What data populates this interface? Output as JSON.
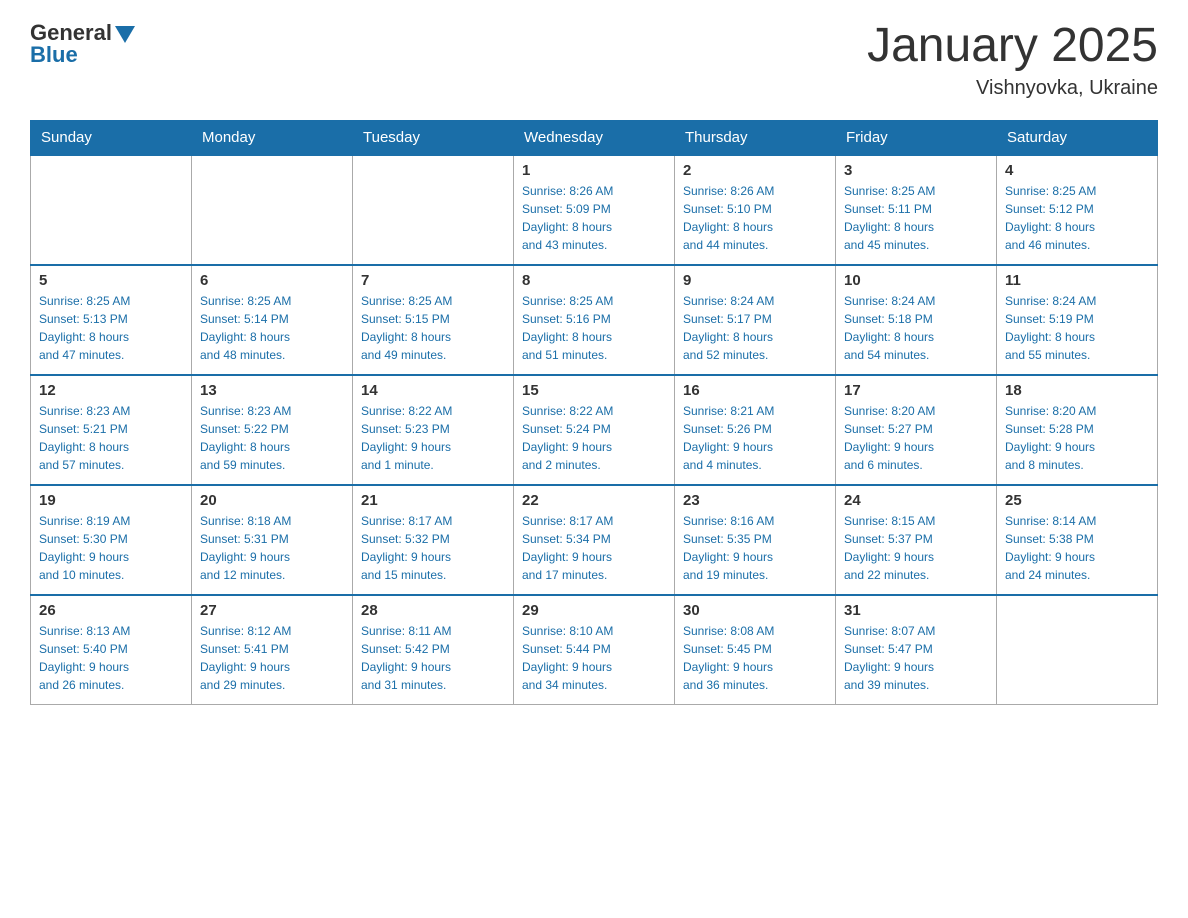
{
  "header": {
    "logo_general": "General",
    "logo_blue": "Blue",
    "title": "January 2025",
    "subtitle": "Vishnyovka, Ukraine"
  },
  "days_of_week": [
    "Sunday",
    "Monday",
    "Tuesday",
    "Wednesday",
    "Thursday",
    "Friday",
    "Saturday"
  ],
  "weeks": [
    [
      {
        "day": "",
        "info": ""
      },
      {
        "day": "",
        "info": ""
      },
      {
        "day": "",
        "info": ""
      },
      {
        "day": "1",
        "info": "Sunrise: 8:26 AM\nSunset: 5:09 PM\nDaylight: 8 hours\nand 43 minutes."
      },
      {
        "day": "2",
        "info": "Sunrise: 8:26 AM\nSunset: 5:10 PM\nDaylight: 8 hours\nand 44 minutes."
      },
      {
        "day": "3",
        "info": "Sunrise: 8:25 AM\nSunset: 5:11 PM\nDaylight: 8 hours\nand 45 minutes."
      },
      {
        "day": "4",
        "info": "Sunrise: 8:25 AM\nSunset: 5:12 PM\nDaylight: 8 hours\nand 46 minutes."
      }
    ],
    [
      {
        "day": "5",
        "info": "Sunrise: 8:25 AM\nSunset: 5:13 PM\nDaylight: 8 hours\nand 47 minutes."
      },
      {
        "day": "6",
        "info": "Sunrise: 8:25 AM\nSunset: 5:14 PM\nDaylight: 8 hours\nand 48 minutes."
      },
      {
        "day": "7",
        "info": "Sunrise: 8:25 AM\nSunset: 5:15 PM\nDaylight: 8 hours\nand 49 minutes."
      },
      {
        "day": "8",
        "info": "Sunrise: 8:25 AM\nSunset: 5:16 PM\nDaylight: 8 hours\nand 51 minutes."
      },
      {
        "day": "9",
        "info": "Sunrise: 8:24 AM\nSunset: 5:17 PM\nDaylight: 8 hours\nand 52 minutes."
      },
      {
        "day": "10",
        "info": "Sunrise: 8:24 AM\nSunset: 5:18 PM\nDaylight: 8 hours\nand 54 minutes."
      },
      {
        "day": "11",
        "info": "Sunrise: 8:24 AM\nSunset: 5:19 PM\nDaylight: 8 hours\nand 55 minutes."
      }
    ],
    [
      {
        "day": "12",
        "info": "Sunrise: 8:23 AM\nSunset: 5:21 PM\nDaylight: 8 hours\nand 57 minutes."
      },
      {
        "day": "13",
        "info": "Sunrise: 8:23 AM\nSunset: 5:22 PM\nDaylight: 8 hours\nand 59 minutes."
      },
      {
        "day": "14",
        "info": "Sunrise: 8:22 AM\nSunset: 5:23 PM\nDaylight: 9 hours\nand 1 minute."
      },
      {
        "day": "15",
        "info": "Sunrise: 8:22 AM\nSunset: 5:24 PM\nDaylight: 9 hours\nand 2 minutes."
      },
      {
        "day": "16",
        "info": "Sunrise: 8:21 AM\nSunset: 5:26 PM\nDaylight: 9 hours\nand 4 minutes."
      },
      {
        "day": "17",
        "info": "Sunrise: 8:20 AM\nSunset: 5:27 PM\nDaylight: 9 hours\nand 6 minutes."
      },
      {
        "day": "18",
        "info": "Sunrise: 8:20 AM\nSunset: 5:28 PM\nDaylight: 9 hours\nand 8 minutes."
      }
    ],
    [
      {
        "day": "19",
        "info": "Sunrise: 8:19 AM\nSunset: 5:30 PM\nDaylight: 9 hours\nand 10 minutes."
      },
      {
        "day": "20",
        "info": "Sunrise: 8:18 AM\nSunset: 5:31 PM\nDaylight: 9 hours\nand 12 minutes."
      },
      {
        "day": "21",
        "info": "Sunrise: 8:17 AM\nSunset: 5:32 PM\nDaylight: 9 hours\nand 15 minutes."
      },
      {
        "day": "22",
        "info": "Sunrise: 8:17 AM\nSunset: 5:34 PM\nDaylight: 9 hours\nand 17 minutes."
      },
      {
        "day": "23",
        "info": "Sunrise: 8:16 AM\nSunset: 5:35 PM\nDaylight: 9 hours\nand 19 minutes."
      },
      {
        "day": "24",
        "info": "Sunrise: 8:15 AM\nSunset: 5:37 PM\nDaylight: 9 hours\nand 22 minutes."
      },
      {
        "day": "25",
        "info": "Sunrise: 8:14 AM\nSunset: 5:38 PM\nDaylight: 9 hours\nand 24 minutes."
      }
    ],
    [
      {
        "day": "26",
        "info": "Sunrise: 8:13 AM\nSunset: 5:40 PM\nDaylight: 9 hours\nand 26 minutes."
      },
      {
        "day": "27",
        "info": "Sunrise: 8:12 AM\nSunset: 5:41 PM\nDaylight: 9 hours\nand 29 minutes."
      },
      {
        "day": "28",
        "info": "Sunrise: 8:11 AM\nSunset: 5:42 PM\nDaylight: 9 hours\nand 31 minutes."
      },
      {
        "day": "29",
        "info": "Sunrise: 8:10 AM\nSunset: 5:44 PM\nDaylight: 9 hours\nand 34 minutes."
      },
      {
        "day": "30",
        "info": "Sunrise: 8:08 AM\nSunset: 5:45 PM\nDaylight: 9 hours\nand 36 minutes."
      },
      {
        "day": "31",
        "info": "Sunrise: 8:07 AM\nSunset: 5:47 PM\nDaylight: 9 hours\nand 39 minutes."
      },
      {
        "day": "",
        "info": ""
      }
    ]
  ]
}
